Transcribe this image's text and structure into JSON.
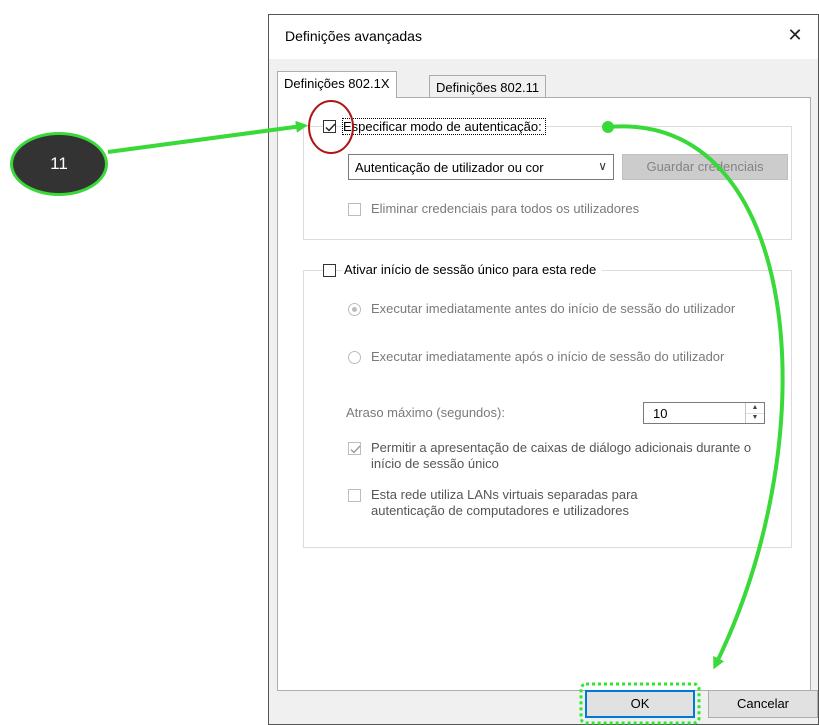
{
  "window": {
    "title": "Definições avançadas"
  },
  "tabs": [
    {
      "label": "Definições 802.1X",
      "active": true
    },
    {
      "label": "Definições 802.11",
      "active": false
    }
  ],
  "auth_group": {
    "specify_mode_label": "Especificar modo de autenticação:",
    "specify_mode_checked": true,
    "auth_mode_selected": "Autenticação de utilizador ou cor",
    "save_credentials_label": "Guardar credenciais",
    "delete_credentials_label": "Eliminar credenciais para todos os utilizadores",
    "delete_credentials_checked": false
  },
  "sso_group": {
    "enable_sso_label": "Ativar início de sessão único para esta rede",
    "enable_sso_checked": false,
    "before_logon_label": "Executar imediatamente antes do início de sessão do utilizador",
    "before_logon_selected": true,
    "after_logon_label": "Executar imediatamente após o início de sessão do utilizador",
    "after_logon_selected": false,
    "max_delay_label": "Atraso máximo (segundos):",
    "max_delay_value": "10",
    "allow_dialogs_label": "Permitir a apresentação de caixas de diálogo adicionais durante o início de sessão único",
    "allow_dialogs_checked": true,
    "separate_vlans_label": "Esta rede utiliza LANs virtuais separadas para autenticação de computadores e utilizadores",
    "separate_vlans_checked": false
  },
  "buttons": {
    "ok_label": "OK",
    "cancel_label": "Cancelar"
  },
  "annotation": {
    "step_number": "11",
    "arrow_color": "#39d939",
    "highlight_circle_color": "#b01515",
    "ok_highlight_color": "#2ee82e"
  },
  "colors": {
    "dialog_bg": "#f0f0f0",
    "panel_bg": "#ffffff",
    "default_button_border": "#0078d7",
    "disabled_text": "#7a7a7a"
  },
  "icons": {
    "close": "close-icon",
    "dropdown": "chevron-down-icon",
    "spin_up": "spin-up-icon",
    "spin_down": "spin-down-icon"
  }
}
